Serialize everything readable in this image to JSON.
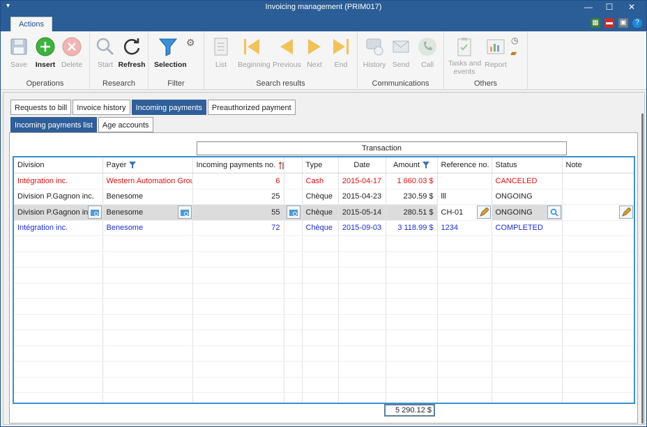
{
  "window": {
    "title": "Invoicing management (PRIM017)"
  },
  "ribbon": {
    "tab_label": "Actions",
    "groups": {
      "operations": {
        "label": "Operations",
        "save": "Save",
        "insert": "Insert",
        "delete": "Delete"
      },
      "research": {
        "label": "Research",
        "start": "Start",
        "refresh": "Refresh"
      },
      "filter": {
        "label": "Filter",
        "selection": "Selection"
      },
      "search_results": {
        "label": "Search results",
        "list": "List",
        "beginning": "Beginning",
        "previous": "Previous",
        "next": "Next",
        "end": "End"
      },
      "communications": {
        "label": "Communications",
        "history": "History",
        "send": "Send",
        "call": "Call"
      },
      "others": {
        "label": "Others",
        "tasks_line1": "Tasks and",
        "tasks_line2": "events",
        "report": "Report"
      }
    }
  },
  "tabs": [
    "Requests to bill",
    "Invoice history",
    "Incoming payments",
    "Preauthorized payment"
  ],
  "subtabs": [
    "Incoming payments list",
    "Age accounts"
  ],
  "grid": {
    "group_header": "Transaction",
    "columns": [
      "Division",
      "Payer",
      "Incoming payments no.",
      "",
      "Type",
      "Date",
      "Amount",
      "Reference no.",
      "Status",
      "Note"
    ],
    "rows": [
      {
        "style": "red",
        "division": "Intégration inc.",
        "payer": "Western Automation Group",
        "no": "6",
        "type": "Cash",
        "date": "2015-04-17",
        "amount": "1 660.03 $",
        "ref": "",
        "status": "CANCELED",
        "note": ""
      },
      {
        "style": "normal",
        "division": "Division P.Gagnon inc.",
        "payer": "Benesome",
        "no": "25",
        "type": "Chèque",
        "date": "2015-04-23",
        "amount": "230.59 $",
        "ref": "lll",
        "status": "ONGOING",
        "note": ""
      },
      {
        "style": "sel",
        "division": "Division P.Gagnon inc.",
        "payer": "Benesome",
        "no": "55",
        "type": "Chèque",
        "date": "2015-05-14",
        "amount": "280.51 $",
        "ref": "CH-01",
        "status": "ONGOING",
        "note": ""
      },
      {
        "style": "blue",
        "division": "Intégration inc.",
        "payer": "Benesome",
        "no": "72",
        "type": "Chèque",
        "date": "2015-09-03",
        "amount": "3 118.99 $",
        "ref": "1234",
        "status": "COMPLETED",
        "note": ""
      }
    ],
    "total": "5 290.12 $"
  },
  "colors": {
    "accent": "#2b5d96",
    "grid_border": "#3a8fd0",
    "canceled": "#e01010",
    "completed": "#1a2ed6"
  }
}
